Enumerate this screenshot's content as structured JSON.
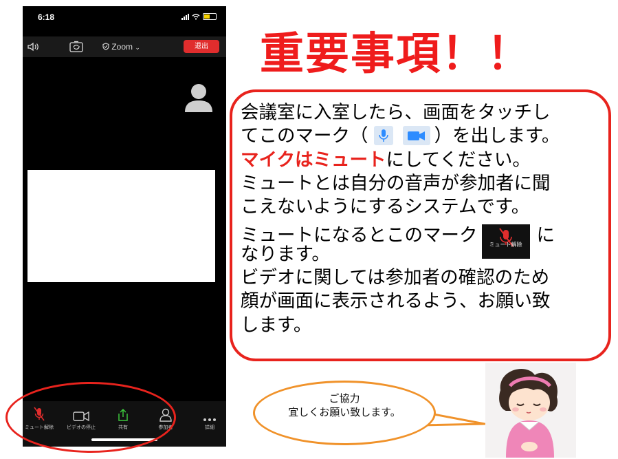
{
  "phone": {
    "status_time": "6:18",
    "toolbar": {
      "zoom_label": "Zoom",
      "leave_label": "退出"
    },
    "controls": [
      {
        "label": "ミュート解除",
        "icon": "mic-muted-icon"
      },
      {
        "label": "ビデオの停止",
        "icon": "video-camera-icon"
      },
      {
        "label": "共有",
        "icon": "share-icon"
      },
      {
        "label": "参加者",
        "icon": "participants-icon"
      },
      {
        "label": "詳細",
        "icon": "more-icon"
      }
    ]
  },
  "headline": "重要事項！！",
  "info": {
    "line1": "会議室に入室したら、画面をタッチし",
    "line2_pre": "てこのマーク（",
    "line2_post": "）を出します。",
    "line3_emph": "マイクはミュート",
    "line3_rest": "にしてください。",
    "line4": "ミュートとは自分の音声が参加者に聞",
    "line5": "こえないようにするシステムです。",
    "line6_pre": "ミュートになるとこのマーク",
    "line6_post": "に",
    "line7": "なります。",
    "line8": "ビデオに関しては参加者の確認のため",
    "line9": "顔が画面に表示されるよう、お願い致",
    "line10": "します。",
    "mute_chip_label": "ミュート解除"
  },
  "bubble": {
    "line1": "ご協力",
    "line2": "宜しくお願い致します。"
  },
  "colors": {
    "accent_red": "#e8231d",
    "bubble_orange": "#f0922a",
    "zoom_blue": "#2d8cff",
    "share_green": "#3cc63c"
  }
}
